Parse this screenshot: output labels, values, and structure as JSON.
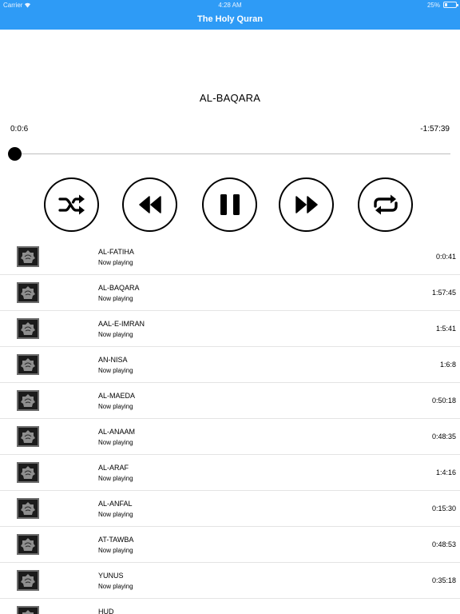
{
  "status_bar": {
    "carrier": "Carrier",
    "time": "4:28 AM",
    "battery": "25%"
  },
  "nav": {
    "title": "The Holy Quran"
  },
  "player": {
    "track_title": "AL-BAQARA",
    "elapsed": "0:0:6",
    "remaining": "-1:57:39",
    "progress": 0.001,
    "accent_color": "#2e9bf6"
  },
  "controls": {
    "shuffle_icon": "shuffle-icon",
    "rewind_icon": "rewind-icon",
    "pause_icon": "pause-icon",
    "forward_icon": "fast-forward-icon",
    "repeat_icon": "repeat-icon"
  },
  "tracks": [
    {
      "name": "AL-FATIHA",
      "status": "Now playing",
      "duration": "0:0:41"
    },
    {
      "name": "AL-BAQARA",
      "status": "Now playing",
      "duration": "1:57:45"
    },
    {
      "name": "AAL-E-IMRAN",
      "status": "Now playing",
      "duration": "1:5:41"
    },
    {
      "name": "AN-NISA",
      "status": "Now playing",
      "duration": "1:6:8"
    },
    {
      "name": "AL-MAEDA",
      "status": "Now playing",
      "duration": "0:50:18"
    },
    {
      "name": "AL-ANAAM",
      "status": "Now playing",
      "duration": "0:48:35"
    },
    {
      "name": "AL-ARAF",
      "status": "Now playing",
      "duration": "1:4:16"
    },
    {
      "name": "AL-ANFAL",
      "status": "Now playing",
      "duration": "0:15:30"
    },
    {
      "name": "AT-TAWBA",
      "status": "Now playing",
      "duration": "0:48:53"
    },
    {
      "name": "YUNUS",
      "status": "Now playing",
      "duration": "0:35:18"
    },
    {
      "name": "HUD",
      "status": "",
      "duration": ""
    }
  ]
}
